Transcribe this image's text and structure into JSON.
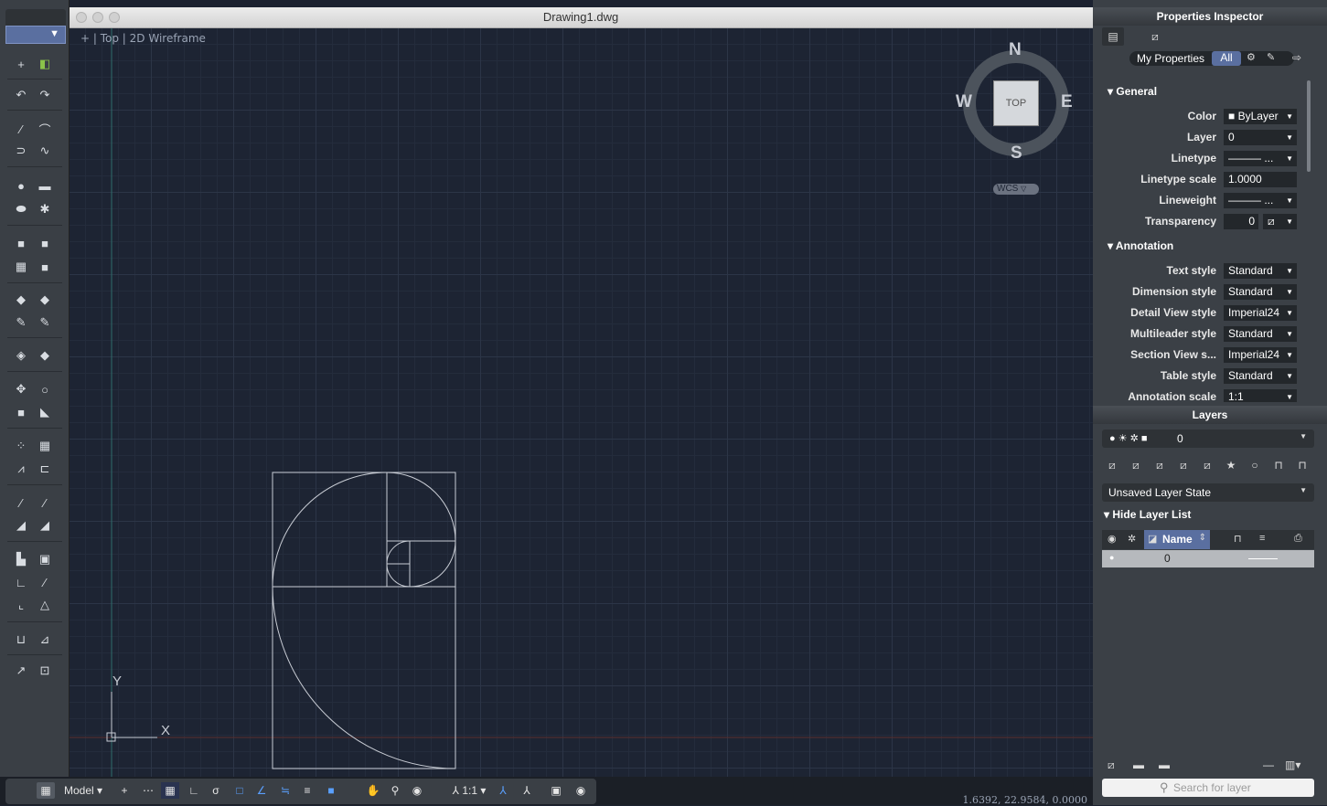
{
  "window": {
    "title": "Drawing1.dwg"
  },
  "viewport": {
    "label": "+ | Top | 2D Wireframe"
  },
  "viewcube": {
    "north": "N",
    "south": "S",
    "east": "E",
    "west": "W",
    "face": "TOP",
    "ucs": "WCS"
  },
  "ucs_axes": {
    "x": "X",
    "y": "Y"
  },
  "status": {
    "model_label": "Model",
    "scale_label": "1:1",
    "coordinates": "1.6392, 22.9584, 0.0000"
  },
  "properties": {
    "title": "Properties Inspector",
    "filter_my": "My Properties",
    "filter_all": "All",
    "general": {
      "heading": "General",
      "rows": [
        {
          "label": "Color",
          "value": "ByLayer"
        },
        {
          "label": "Layer",
          "value": "0"
        },
        {
          "label": "Linetype",
          "value": "——— ..."
        },
        {
          "label": "Linetype scale",
          "value": "1.0000"
        },
        {
          "label": "Lineweight",
          "value": "——— ..."
        },
        {
          "label": "Transparency",
          "value": "0"
        }
      ]
    },
    "annotation": {
      "heading": "Annotation",
      "rows": [
        {
          "label": "Text style",
          "value": "Standard"
        },
        {
          "label": "Dimension style",
          "value": "Standard"
        },
        {
          "label": "Detail View style",
          "value": "Imperial24"
        },
        {
          "label": "Multileader style",
          "value": "Standard"
        },
        {
          "label": "Section View s...",
          "value": "Imperial24"
        },
        {
          "label": "Table style",
          "value": "Standard"
        },
        {
          "label": "Annotation scale",
          "value": "1:1"
        }
      ]
    }
  },
  "layers": {
    "title": "Layers",
    "current_layer": "0",
    "layer_state": "Unsaved Layer State",
    "hide_list": "Hide Layer List",
    "column_name": "Name",
    "rows": [
      {
        "name": "0"
      }
    ],
    "search_placeholder": "Search for layer"
  },
  "colors": {
    "canvas": "#1d2433",
    "panel": "#3b4046",
    "accent": "#5a6fa0",
    "drawing": "#c8ccd4"
  }
}
